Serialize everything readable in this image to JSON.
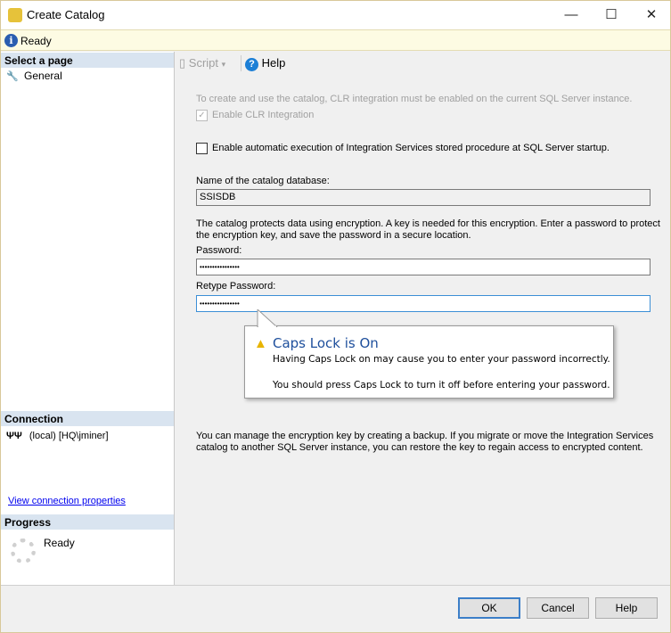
{
  "window": {
    "title": "Create Catalog",
    "minimize": "—",
    "maximize": "☐",
    "close": "✕"
  },
  "status": {
    "text": "Ready"
  },
  "left": {
    "select_page": "Select a page",
    "pages": [
      {
        "label": "General"
      }
    ],
    "connection_header": "Connection",
    "connection": "(local) [HQ\\jminer]",
    "view_connection": "View connection properties",
    "progress_header": "Progress",
    "progress_status": "Ready"
  },
  "toolbar": {
    "script": "Script",
    "help": "Help"
  },
  "form": {
    "clr_note": "To create and use the catalog, CLR integration must be enabled on the current SQL Server instance.",
    "enable_clr": "Enable CLR Integration",
    "enable_clr_checked": true,
    "auto_exec": "Enable automatic execution of Integration Services stored procedure at SQL Server startup.",
    "auto_exec_checked": false,
    "db_name_label": "Name of the catalog database:",
    "db_name": "SSISDB",
    "encryption_note_1": "The catalog protects data using encryption. A key is needed for this encryption. Enter a password to protect",
    "encryption_note_2": "the encryption key, and save the password in a secure location.",
    "password_label": "Password:",
    "password": "••••••••••••••••",
    "retype_label": "Retype Password:",
    "retype": "••••••••••••••••",
    "backup_note_1": "You can manage the encryption key by creating a backup. If you migrate or move the Integration Services",
    "backup_note_2": "catalog to another SQL Server instance, you can restore the key to regain access to encrypted content."
  },
  "tooltip": {
    "title": "Caps Lock is On",
    "line1": "Having Caps Lock on may cause you to enter your password incorrectly.",
    "line2": "You should press Caps Lock to turn it off before entering your password."
  },
  "buttons": {
    "ok": "OK",
    "cancel": "Cancel",
    "help": "Help"
  }
}
